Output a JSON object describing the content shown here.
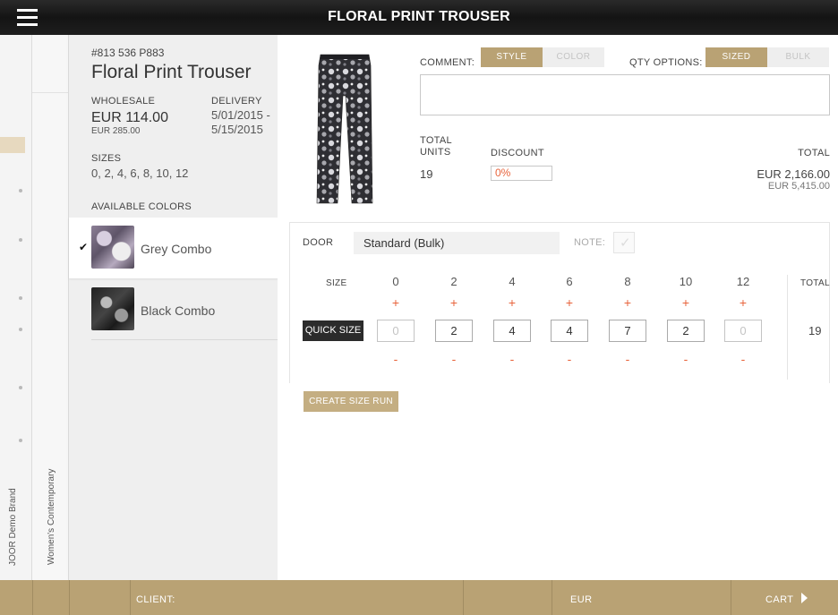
{
  "header": {
    "title": "FLORAL PRINT TROUSER",
    "menu_icon": "hamburger-menu-icon"
  },
  "side_rails": {
    "brand": "JOOR Demo Brand",
    "category": "Women's Contemporary"
  },
  "product": {
    "sku": "#813 536 P883",
    "name": "Floral Print Trouser",
    "wholesale_label": "WHOLESALE",
    "wholesale_price": "EUR 114.00",
    "retail_price": "EUR 285.00",
    "delivery_label": "DELIVERY",
    "delivery_value": "5/01/2015 - 5/15/2015",
    "sizes_label": "SIZES",
    "sizes_value": "0, 2, 4, 6, 8, 10, 12",
    "colors_label": "AVAILABLE COLORS",
    "colors": [
      {
        "name": "Grey Combo",
        "selected": true,
        "check": "✔"
      },
      {
        "name": "Black Combo",
        "selected": false
      }
    ]
  },
  "order": {
    "comment_label": "COMMENT:",
    "comment_toggle": [
      {
        "label": "STYLE",
        "active": true
      },
      {
        "label": "COLOR",
        "active": false
      }
    ],
    "qty_label": "QTY OPTIONS:",
    "qty_toggle": [
      {
        "label": "SIZED",
        "active": true
      },
      {
        "label": "BULK",
        "active": false
      }
    ],
    "comment_value": "",
    "total_units_label": "TOTAL UNITS",
    "total_units": "19",
    "discount_label": "DISCOUNT",
    "discount_value": "0%",
    "total_label": "TOTAL",
    "total_value": "EUR 2,166.00",
    "total_retail": "EUR 5,415.00"
  },
  "door": {
    "label": "DOOR",
    "selected": "Standard (Bulk)",
    "note_label": "NOTE:",
    "note_check": "✓"
  },
  "size_grid": {
    "size_label": "SIZE",
    "total_label": "TOTAL",
    "total": "19",
    "plus": "+",
    "minus": "-",
    "sizes": [
      "0",
      "2",
      "4",
      "6",
      "8",
      "10",
      "12"
    ],
    "quantities": [
      "0",
      "2",
      "4",
      "4",
      "7",
      "2",
      "0"
    ],
    "quick_size_label": "QUICK SIZE",
    "create_size_run_label": "CREATE SIZE RUN"
  },
  "footer": {
    "client_label": "CLIENT:",
    "currency": "EUR",
    "cart_label": "CART"
  },
  "colors": {
    "accent_gold": "#b9a274",
    "header_dark": "#1a1a1a",
    "plus_minus": "#e8643c"
  }
}
